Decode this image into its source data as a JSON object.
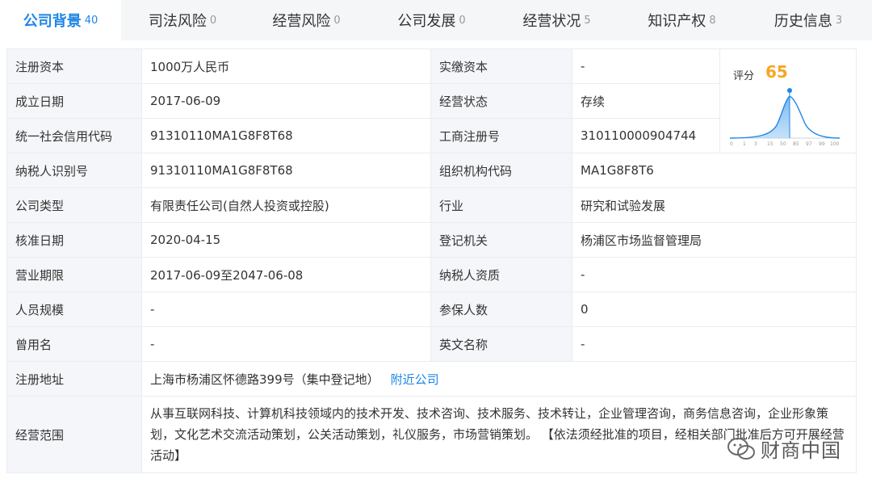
{
  "tabs": [
    {
      "label": "公司背景",
      "count": "40",
      "active": true
    },
    {
      "label": "司法风险",
      "count": "0"
    },
    {
      "label": "经营风险",
      "count": "0"
    },
    {
      "label": "公司发展",
      "count": "0"
    },
    {
      "label": "经营状况",
      "count": "5"
    },
    {
      "label": "知识产权",
      "count": "8"
    },
    {
      "label": "历史信息",
      "count": "3"
    }
  ],
  "rows": [
    {
      "l1": "注册资本",
      "v1": "1000万人民币",
      "l2": "实缴资本",
      "v2": "-"
    },
    {
      "l1": "成立日期",
      "v1": "2017-06-09",
      "l2": "经营状态",
      "v2": "存续"
    },
    {
      "l1": "统一社会信用代码",
      "v1": "91310110MA1G8F8T68",
      "l2": "工商注册号",
      "v2": "310110000904744"
    },
    {
      "l1": "纳税人识别号",
      "v1": "91310110MA1G8F8T68",
      "l2": "组织机构代码",
      "v2": "MA1G8F8T6"
    },
    {
      "l1": "公司类型",
      "v1": "有限责任公司(自然人投资或控股)",
      "l2": "行业",
      "v2": "研究和试验发展"
    },
    {
      "l1": "核准日期",
      "v1": "2020-04-15",
      "l2": "登记机关",
      "v2": "杨浦区市场监督管理局"
    },
    {
      "l1": "营业期限",
      "v1": "2017-06-09至2047-06-08",
      "l2": "纳税人资质",
      "v2": "-"
    },
    {
      "l1": "人员规模",
      "v1": "-",
      "l2": "参保人数",
      "v2": "0"
    },
    {
      "l1": "曾用名",
      "v1": "-",
      "l2": "英文名称",
      "v2": "-"
    }
  ],
  "address": {
    "label": "注册地址",
    "value": "上海市杨浦区怀德路399号（集中登记地）",
    "link": "附近公司"
  },
  "scope": {
    "label": "经营范围",
    "value": "从事互联网科技、计算机科技领域内的技术开发、技术咨询、技术服务、技术转让，企业管理咨询，商务信息咨询，企业形象策划，文化艺术交流活动策划，公关活动策划，礼仪服务，市场营销策划。 【依法须经批准的项目，经相关部门批准后方可开展经营活动】"
  },
  "score": {
    "label": "评分",
    "value": "65",
    "ticks": [
      "0",
      "1",
      "3",
      "15",
      "50",
      "85",
      "97",
      "99",
      "100"
    ]
  },
  "watermark": {
    "text": "财商中国"
  },
  "colors": {
    "accent": "#1f86e6",
    "score": "#f5a623"
  }
}
